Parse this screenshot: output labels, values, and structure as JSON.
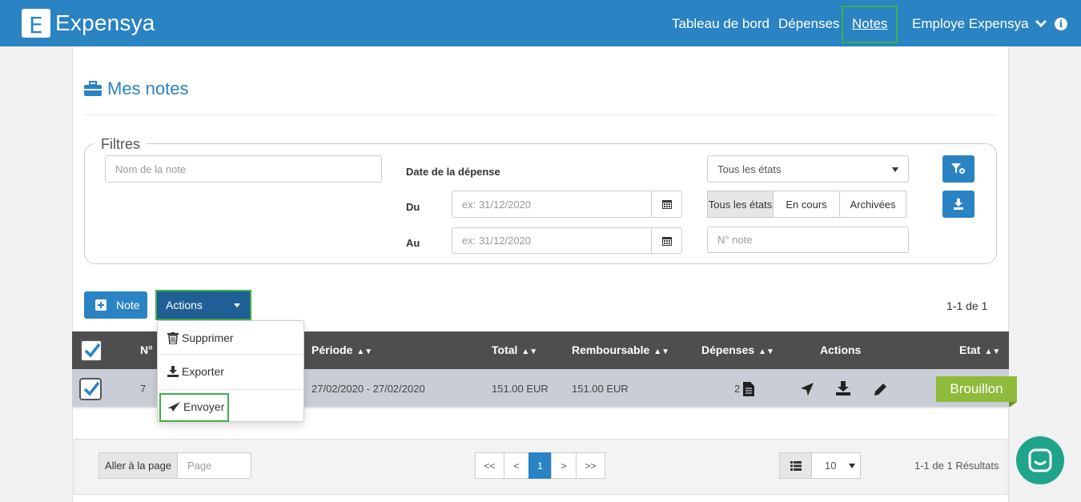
{
  "app": {
    "brand_letter": "E",
    "brand_name": "Expensya"
  },
  "nav": {
    "items": [
      "Tableau de bord",
      "Dépenses",
      "Notes",
      "Employe Expensya"
    ],
    "active": "Notes"
  },
  "page": {
    "title": "Mes notes"
  },
  "filters": {
    "legend": "Filtres",
    "name_placeholder": "Nom de la note",
    "date_label": "Date de la dépense",
    "from_label": "Du",
    "to_label": "Au",
    "date_placeholder": "ex: 31/12/2020",
    "state_select": "Tous les états",
    "state_tabs": [
      "Tous les états",
      "En cours",
      "Archivées"
    ],
    "note_number_placeholder": "N° note"
  },
  "toolbar": {
    "new_note": "Note",
    "actions": "Actions",
    "count": "1-1 de 1"
  },
  "actions_menu": [
    "Supprimer",
    "Exporter",
    "Envoyer"
  ],
  "table": {
    "headers": [
      "N°",
      "Période",
      "Total",
      "Remboursable",
      "Dépenses",
      "Actions",
      "Etat"
    ],
    "rows": [
      {
        "number": "7",
        "period": "27/02/2020 - 27/02/2020",
        "total": "151.00 EUR",
        "refundable": "151.00 EUR",
        "expenses": "2",
        "status": "Brouillon"
      }
    ]
  },
  "pagination": {
    "goto_label": "Aller à la page",
    "page_placeholder": "Page",
    "buttons": [
      "<<",
      "<",
      "1",
      ">",
      ">>"
    ],
    "current": "1",
    "page_size": "10",
    "results": "1-1 de 1 Résultats"
  },
  "colors": {
    "primary": "#2a83c3",
    "highlight": "#3fae49",
    "status_draft": "#8fba3c",
    "chat": "#1fa38b"
  }
}
